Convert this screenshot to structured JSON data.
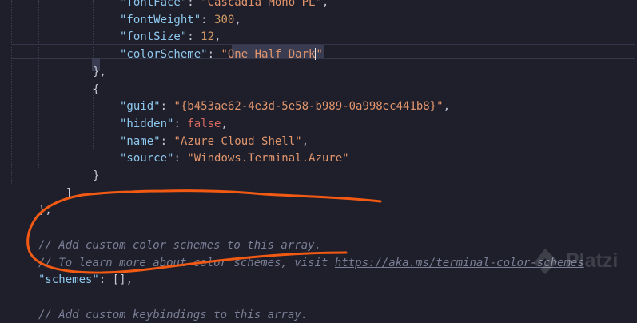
{
  "colors": {
    "background": "#1e1f2b",
    "key": "#8fc8ee",
    "string": "#e2956c",
    "boolean": "#d8685f",
    "comment": "#7b7f95",
    "annotation": "#f25a13"
  },
  "lines": [
    [
      {
        "t": "key",
        "v": "\"fontFace\""
      },
      {
        "t": "punc",
        "v": ": "
      },
      {
        "t": "str",
        "v": "\"Cascadia Mono PL\""
      },
      {
        "t": "punc",
        "v": ","
      }
    ],
    [
      {
        "t": "key",
        "v": "\"fontWeight\""
      },
      {
        "t": "punc",
        "v": ": "
      },
      {
        "t": "num",
        "v": "300"
      },
      {
        "t": "punc",
        "v": ","
      }
    ],
    [
      {
        "t": "key",
        "v": "\"fontSize\""
      },
      {
        "t": "punc",
        "v": ": "
      },
      {
        "t": "num",
        "v": "12"
      },
      {
        "t": "punc",
        "v": ","
      }
    ],
    [
      {
        "t": "key",
        "v": "\"colorScheme\""
      },
      {
        "t": "punc",
        "v": ": "
      },
      {
        "t": "str",
        "v": "\"One Half Dark"
      },
      {
        "t": "cursor",
        "v": ""
      },
      {
        "t": "str",
        "v": "\""
      }
    ],
    [
      {
        "t": "punc",
        "v": "},"
      }
    ],
    [
      {
        "t": "punc",
        "v": "{"
      }
    ],
    [
      {
        "t": "key",
        "v": "\"guid\""
      },
      {
        "t": "punc",
        "v": ": "
      },
      {
        "t": "str",
        "v": "\"{b453ae62-4e3d-5e58-b989-0a998ec441b8}\""
      },
      {
        "t": "punc",
        "v": ","
      }
    ],
    [
      {
        "t": "key",
        "v": "\"hidden\""
      },
      {
        "t": "punc",
        "v": ": "
      },
      {
        "t": "bool",
        "v": "false"
      },
      {
        "t": "punc",
        "v": ","
      }
    ],
    [
      {
        "t": "key",
        "v": "\"name\""
      },
      {
        "t": "punc",
        "v": ": "
      },
      {
        "t": "str",
        "v": "\"Azure Cloud Shell\""
      },
      {
        "t": "punc",
        "v": ","
      }
    ],
    [
      {
        "t": "key",
        "v": "\"source\""
      },
      {
        "t": "punc",
        "v": ": "
      },
      {
        "t": "str",
        "v": "\"Windows.Terminal.Azure\""
      }
    ],
    [
      {
        "t": "punc",
        "v": "}"
      }
    ],
    [
      {
        "t": "punc",
        "v": "]"
      }
    ],
    [
      {
        "t": "punc",
        "v": "},"
      }
    ],
    [],
    [
      {
        "t": "comment",
        "v": "// Add custom color schemes to this array."
      }
    ],
    [
      {
        "t": "comment",
        "v": "// To learn more about color schemes, visit "
      },
      {
        "t": "link",
        "v": "https://aka.ms/terminal-color-schemes"
      }
    ],
    [
      {
        "t": "key",
        "v": "\"schemes\""
      },
      {
        "t": "punc",
        "v": ": [],"
      }
    ],
    [],
    [
      {
        "t": "comment",
        "v": "// Add custom keybindings to this array."
      }
    ]
  ],
  "watermark": {
    "text": "Platzi"
  }
}
